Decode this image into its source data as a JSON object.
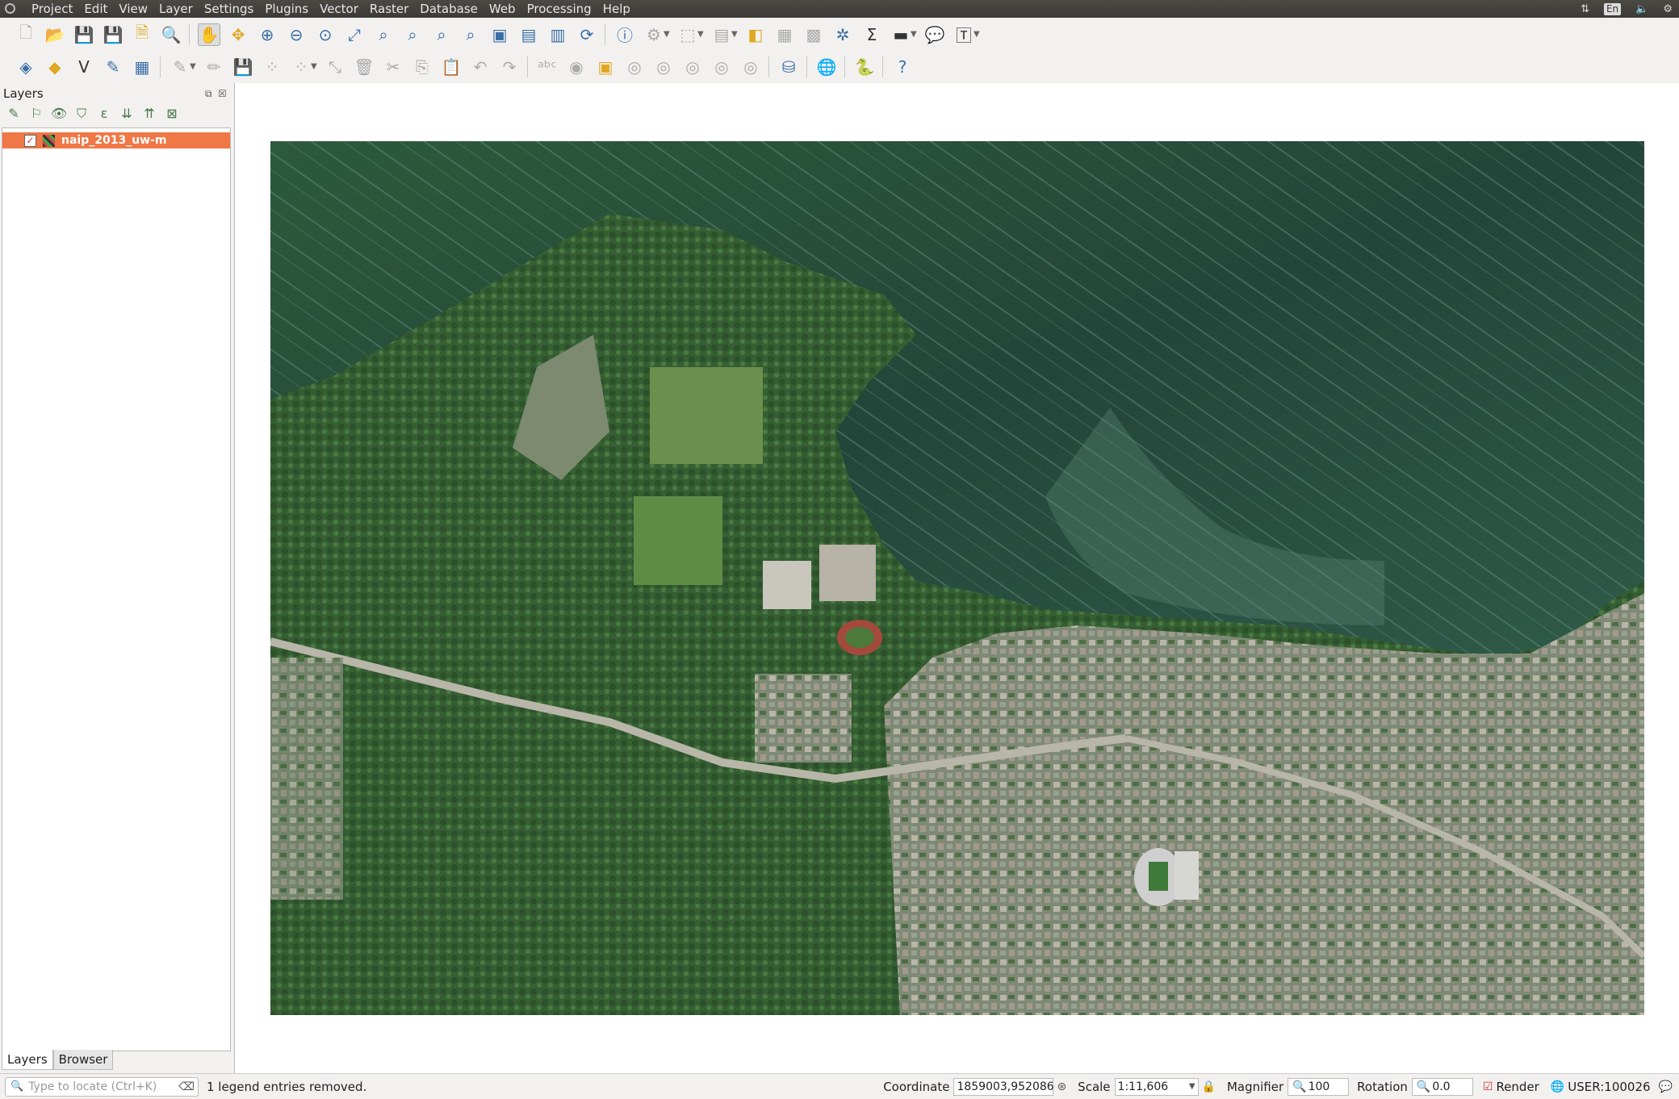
{
  "menubar": {
    "items": [
      "Project",
      "Edit",
      "View",
      "Layer",
      "Settings",
      "Plugins",
      "Vector",
      "Raster",
      "Database",
      "Web",
      "Processing",
      "Help"
    ],
    "lang": "En"
  },
  "layers_panel": {
    "title": "Layers",
    "layer": {
      "name": "naip_2013_uw-m",
      "checked": true
    },
    "tabs": [
      "Layers",
      "Browser"
    ]
  },
  "statusbar": {
    "locate_placeholder": "Type to locate (Ctrl+K)",
    "message": "1 legend entries removed.",
    "coordinate_label": "Coordinate",
    "coordinate_value": "1859003,952086",
    "scale_label": "Scale",
    "scale_value": "1:11,606",
    "magnifier_label": "Magnifier",
    "magnifier_value": "100",
    "rotation_label": "Rotation",
    "rotation_value": "0.0",
    "render_label": "Render",
    "crs_label": "USER:100026"
  },
  "colors": {
    "selected_layer": "#f07746",
    "lake": "#2b4f3a",
    "land": "#3c6b3a",
    "urban": "#8f9484"
  }
}
